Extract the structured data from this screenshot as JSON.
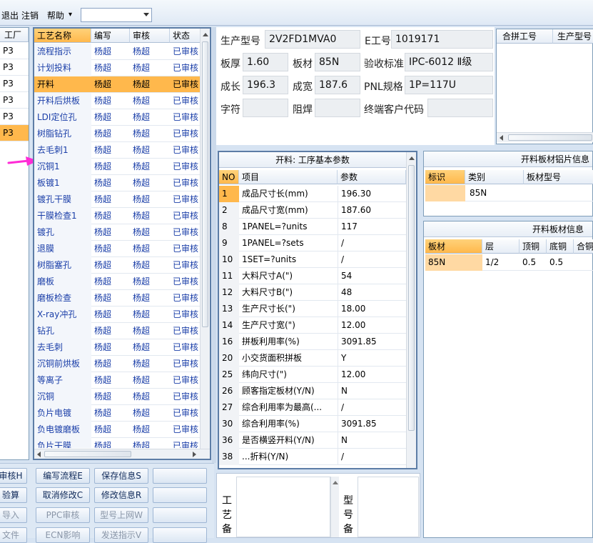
{
  "menu": {
    "exit": "退出",
    "logout": "注销",
    "help": "帮助",
    "help_arrow": "▾",
    "combo_value": ""
  },
  "left_panel": {
    "header": "工厂",
    "items": [
      "P3",
      "P3",
      "P3",
      "P3",
      "P3",
      "P3"
    ],
    "selected_index": 5
  },
  "process_table": {
    "headers": [
      "工艺名称",
      "编写",
      "审核",
      "状态"
    ],
    "selected_index": 2,
    "rows": [
      {
        "name": "流程指示",
        "writer": "杨超",
        "reviewer": "杨超",
        "status": "已审核"
      },
      {
        "name": "计划投料",
        "writer": "杨超",
        "reviewer": "杨超",
        "status": "已审核"
      },
      {
        "name": "开料",
        "writer": "杨超",
        "reviewer": "杨超",
        "status": "已审核"
      },
      {
        "name": "开料后烘板",
        "writer": "杨超",
        "reviewer": "杨超",
        "status": "已审核"
      },
      {
        "name": "LDI定位孔",
        "writer": "杨超",
        "reviewer": "杨超",
        "status": "已审核"
      },
      {
        "name": "树脂钻孔",
        "writer": "杨超",
        "reviewer": "杨超",
        "status": "已审核"
      },
      {
        "name": "去毛刺1",
        "writer": "杨超",
        "reviewer": "杨超",
        "status": "已审核"
      },
      {
        "name": "沉铜1",
        "writer": "杨超",
        "reviewer": "杨超",
        "status": "已审核"
      },
      {
        "name": "板镀1",
        "writer": "杨超",
        "reviewer": "杨超",
        "status": "已审核"
      },
      {
        "name": "镀孔干膜",
        "writer": "杨超",
        "reviewer": "杨超",
        "status": "已审核"
      },
      {
        "name": "干膜检查1",
        "writer": "杨超",
        "reviewer": "杨超",
        "status": "已审核"
      },
      {
        "name": "镀孔",
        "writer": "杨超",
        "reviewer": "杨超",
        "status": "已审核"
      },
      {
        "name": "退膜",
        "writer": "杨超",
        "reviewer": "杨超",
        "status": "已审核"
      },
      {
        "name": "树脂塞孔",
        "writer": "杨超",
        "reviewer": "杨超",
        "status": "已审核"
      },
      {
        "name": "磨板",
        "writer": "杨超",
        "reviewer": "杨超",
        "status": "已审核"
      },
      {
        "name": "磨板检查",
        "writer": "杨超",
        "reviewer": "杨超",
        "status": "已审核"
      },
      {
        "name": "X-ray冲孔",
        "writer": "杨超",
        "reviewer": "杨超",
        "status": "已审核"
      },
      {
        "name": "钻孔",
        "writer": "杨超",
        "reviewer": "杨超",
        "status": "已审核"
      },
      {
        "name": "去毛刺",
        "writer": "杨超",
        "reviewer": "杨超",
        "status": "已审核"
      },
      {
        "name": "沉铜前烘板",
        "writer": "杨超",
        "reviewer": "杨超",
        "status": "已审核"
      },
      {
        "name": "等离子",
        "writer": "杨超",
        "reviewer": "杨超",
        "status": "已审核"
      },
      {
        "name": "沉铜",
        "writer": "杨超",
        "reviewer": "杨超",
        "status": "已审核"
      },
      {
        "name": "负片电镀",
        "writer": "杨超",
        "reviewer": "杨超",
        "status": "已审核"
      },
      {
        "name": "负电镀磨板",
        "writer": "杨超",
        "reviewer": "杨超",
        "status": "已审核"
      },
      {
        "name": "负片干膜",
        "writer": "杨超",
        "reviewer": "杨超",
        "status": "已审核"
      }
    ]
  },
  "buttons": {
    "review": "审核H",
    "edit_flow": "编写流程E",
    "save_info": "保存信息S",
    "blank1": "",
    "calc": "验算",
    "cancel_edit": "取消修改C",
    "modify_info": "修改信息R",
    "blank2": "",
    "import": "导入",
    "ppc_review": "PPC审核",
    "model_upload": "型号上网W",
    "blank3": "",
    "file": "文件",
    "ecn_effect": "ECN影响",
    "send_instruction": "发送指示V",
    "blank4": ""
  },
  "info": {
    "model_label": "生产型号",
    "model_value": "2V2FD1MVA0",
    "eno_label": "E工号",
    "eno_value": "1019171",
    "thickness_label": "板厚",
    "thickness_value": "1.60",
    "material_label": "板材",
    "material_value": "85N",
    "standard_label": "验收标准",
    "standard_value": "IPC-6012 Ⅱ级",
    "length_label": "成长",
    "length_value": "196.3",
    "width_label": "成宽",
    "width_value": "187.6",
    "pnl_label": "PNL规格",
    "pnl_value": "1P=117U",
    "char_label": "字符",
    "char_value": "",
    "solder_label": "阻焊",
    "solder_value": "",
    "customer_label": "终端客户代码",
    "customer_value": ""
  },
  "merge_table": {
    "headers": [
      "合拼工号",
      "生产型号"
    ]
  },
  "params": {
    "title": "开料: 工序基本参数",
    "headers": [
      "NO",
      "项目",
      "参数"
    ],
    "selected_index": 0,
    "rows": [
      {
        "no": "1",
        "item": "成品尺寸长(mm)",
        "value": "196.30"
      },
      {
        "no": "2",
        "item": "成品尺寸宽(mm)",
        "value": "187.60"
      },
      {
        "no": "8",
        "item": "1PANEL=?units",
        "value": "117"
      },
      {
        "no": "9",
        "item": "1PANEL=?sets",
        "value": "/"
      },
      {
        "no": "10",
        "item": "1SET=?units",
        "value": "/"
      },
      {
        "no": "11",
        "item": "大料尺寸A(\")",
        "value": "54"
      },
      {
        "no": "12",
        "item": "大料尺寸B(\")",
        "value": "48"
      },
      {
        "no": "13",
        "item": "生产尺寸长(\")",
        "value": "18.00"
      },
      {
        "no": "14",
        "item": "生产尺寸宽(\")",
        "value": "12.00"
      },
      {
        "no": "16",
        "item": "拼板利用率(%)",
        "value": "3091.85"
      },
      {
        "no": "20",
        "item": "小交货面积拼板",
        "value": "Y"
      },
      {
        "no": "25",
        "item": "纬向尺寸(\")",
        "value": "12.00"
      },
      {
        "no": "26",
        "item": "顾客指定板材(Y/N)",
        "value": "N"
      },
      {
        "no": "27",
        "item": "综合利用率为最高(...",
        "value": "/"
      },
      {
        "no": "30",
        "item": "综合利用率(%)",
        "value": "3091.85"
      },
      {
        "no": "36",
        "item": "是否横竖开料(Y/N)",
        "value": "N"
      },
      {
        "no": "38",
        "item": "...折料(Y/N)",
        "value": "/"
      }
    ]
  },
  "aluminum": {
    "title": "开料板材铝片信息",
    "headers": [
      "标识",
      "类别",
      "板材型号"
    ],
    "row": {
      "id": "",
      "category": "85N",
      "model": ""
    }
  },
  "board_info": {
    "title": "开料板材信息",
    "headers": [
      "板材",
      "层",
      "顶铜",
      "底铜",
      "合铜"
    ],
    "row": {
      "material": "85N",
      "layer": "1/2",
      "top": "0.5",
      "bottom": "0.5",
      "total": ""
    }
  },
  "bottom": {
    "process_note": "工艺备",
    "model_note": "型号备"
  }
}
